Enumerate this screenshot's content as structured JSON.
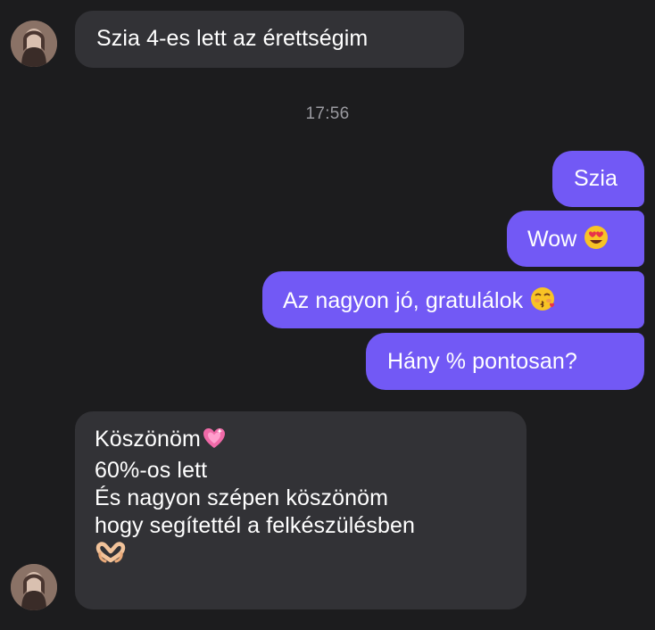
{
  "conversation": {
    "messages": [
      {
        "side": "incoming",
        "text": "Szia 4-es lett az érettségim"
      },
      {
        "side": "outgoing",
        "text": "Szia"
      },
      {
        "side": "outgoing",
        "text": "Wow",
        "emoji": "heart-eyes-emoji"
      },
      {
        "side": "outgoing",
        "text": "Az nagyon jó, gratulálok",
        "emoji": "kissing-closed-eyes-emoji"
      },
      {
        "side": "outgoing",
        "text": "Hány % pontosan?"
      },
      {
        "side": "incoming",
        "lines": [
          "Köszönöm",
          "60%-os lett",
          "És nagyon szépen köszönöm",
          "hogy segítettél a felkészülésben"
        ],
        "emoji": [
          "sparkling-heart-emoji",
          "heart-hands-emoji"
        ]
      }
    ],
    "timestamp": "17:56"
  },
  "colors": {
    "background": "#1c1c1e",
    "incoming_bubble": "#323236",
    "outgoing_bubble": "#7259f5",
    "timestamp_text": "#9a9aa0"
  }
}
